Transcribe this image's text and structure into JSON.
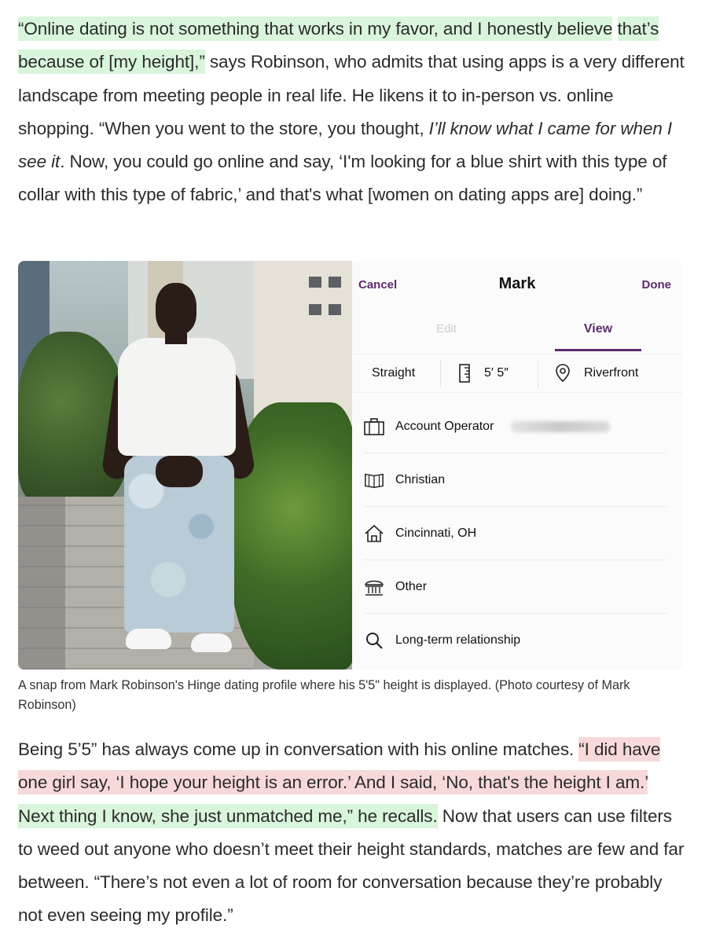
{
  "paragraph1": {
    "hl1_line1": "“Online dating is not something that works in my favor, and I honestly believe",
    "hl1_line2": "that’s because of [my height],”",
    "t1": " says Robinson, who admits that using apps is a very different landscape from meeting people in real life. He likens it to in-person vs. online shopping. “When you went to the store, you thought, ",
    "italic": "I’ll know what I came for when I see it",
    "t2": ". Now, you could go online and say, ‘I'm looking for a blue shirt with this type of collar with this type of fabric,’ and that's what [women on dating apps are] doing.”"
  },
  "figure": {
    "profile": {
      "cancel": "Cancel",
      "name": "Mark",
      "done": "Done",
      "tab_edit": "Edit",
      "tab_view": "View",
      "orientation": "Straight",
      "height": "5′ 5″",
      "location": "Riverfront",
      "job": "Account Operator",
      "religion": "Christian",
      "hometown": "Cincinnati, OH",
      "politics": "Other",
      "looking_for": "Long-term relationship"
    },
    "caption": "A snap from Mark Robinson's Hinge dating profile where his 5'5\" height is displayed. (Photo courtesy of Mark Robinson)"
  },
  "paragraph2": {
    "t1": "Being 5’5” has always come up in conversation with his online matches. ",
    "hl_red": "“I did have one girl say, ‘I hope your height is an error.’ And I said, ‘No, that's the height I am.’",
    "space": " ",
    "hl_green": "Next thing I know, she just unmatched me,” he recalls.",
    "t2": " Now that users can use filters to weed out anyone who doesn’t meet their height standards, matches are few and far between. “There’s not even a lot of room for conversation because they’re probably not even seeing my profile.”"
  },
  "colors": {
    "highlight_green": "#d9f5dc",
    "highlight_red": "#f8d9da",
    "hinge_purple": "#5c2a6e"
  }
}
